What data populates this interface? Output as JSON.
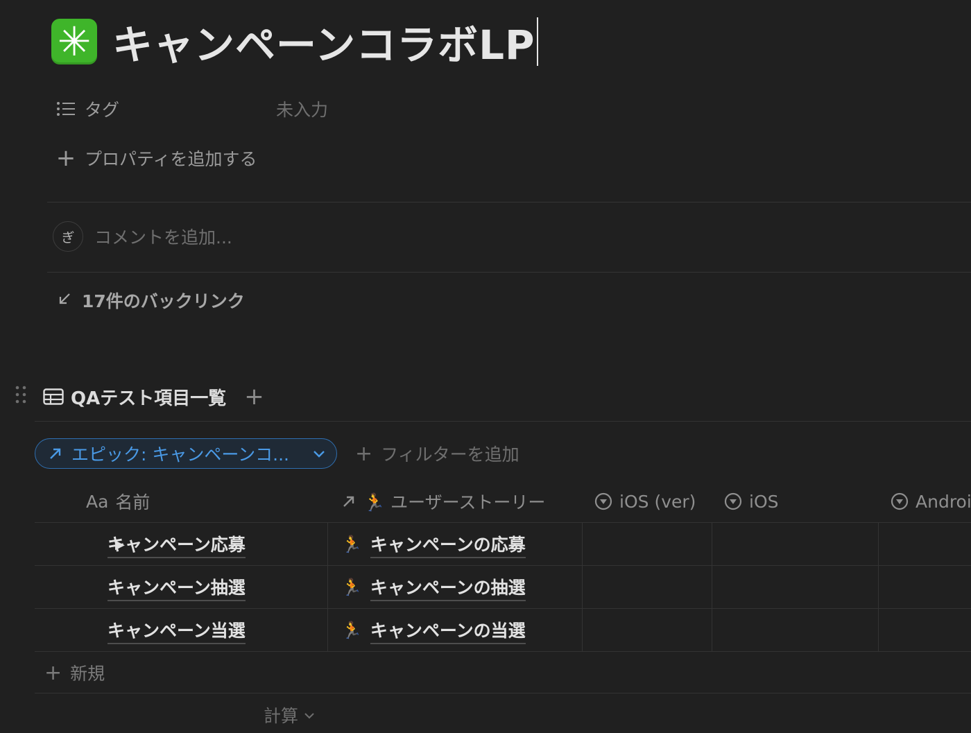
{
  "page": {
    "icon": "✳",
    "title": "キャンペーンコラボLP"
  },
  "properties": [
    {
      "icon": "list-icon",
      "label": "タグ",
      "value": "未入力"
    }
  ],
  "add_property_label": "プロパティを追加する",
  "comment": {
    "avatar_initial": "ぎ",
    "placeholder": "コメントを追加..."
  },
  "backlinks_label": "17件のバックリンク",
  "database": {
    "title": "QAテスト項目一覧",
    "filter_pill": "エピック: キャンペーンコ...",
    "add_filter_label": "フィルターを追加",
    "columns": [
      {
        "icon": "text-icon",
        "icon_text": "Aa",
        "label": "名前"
      },
      {
        "icon": "relation-arrow-icon",
        "icon_text": "↗",
        "label": "🏃 ユーザーストーリー"
      },
      {
        "icon": "select-icon",
        "label": "iOS (ver)"
      },
      {
        "icon": "select-icon",
        "label": "iOS"
      },
      {
        "icon": "select-icon",
        "label": "Androi"
      }
    ],
    "rows": [
      {
        "name": "キャンペーン応募",
        "story": "キャンペーンの応募",
        "has_toggle": true
      },
      {
        "name": "キャンペーン抽選",
        "story": "キャンペーンの抽選",
        "has_toggle": false
      },
      {
        "name": "キャンペーン当選",
        "story": "キャンペーンの当選",
        "has_toggle": false
      }
    ],
    "story_emoji": "🏃",
    "new_row_label": "新規",
    "calc_label": "計算"
  },
  "colors": {
    "background": "#202020",
    "accent_blue": "#4a9ae6",
    "icon_green": "#3fb52a"
  }
}
